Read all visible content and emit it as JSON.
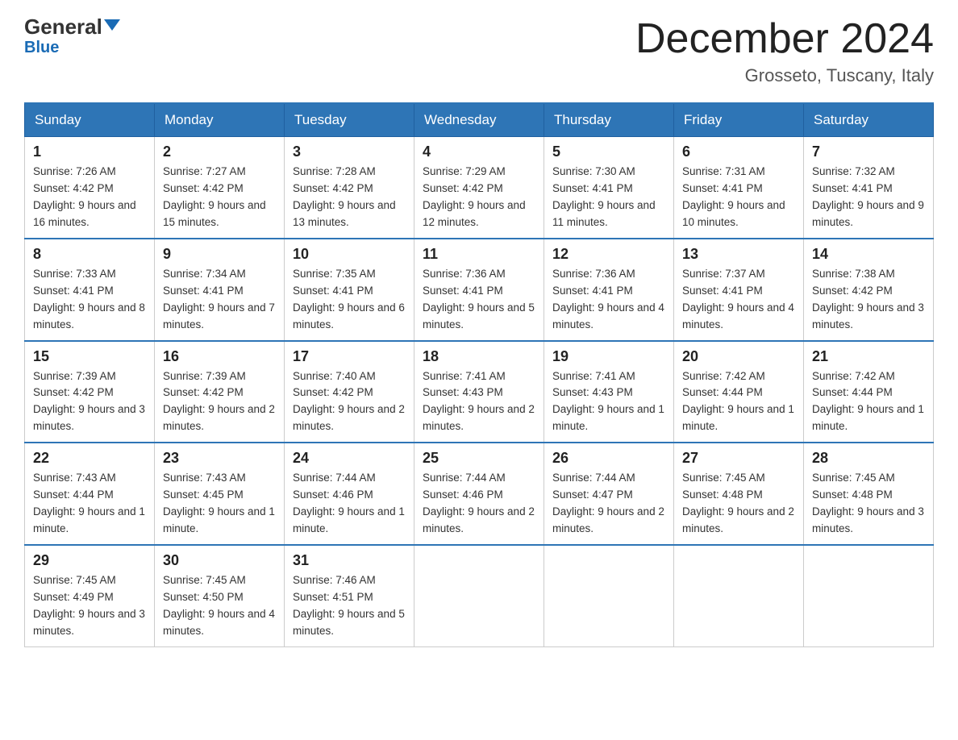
{
  "header": {
    "logo_general": "General",
    "logo_blue": "Blue",
    "month_title": "December 2024",
    "location": "Grosseto, Tuscany, Italy"
  },
  "days_of_week": [
    "Sunday",
    "Monday",
    "Tuesday",
    "Wednesday",
    "Thursday",
    "Friday",
    "Saturday"
  ],
  "weeks": [
    [
      {
        "day": "1",
        "sunrise": "7:26 AM",
        "sunset": "4:42 PM",
        "daylight": "9 hours and 16 minutes."
      },
      {
        "day": "2",
        "sunrise": "7:27 AM",
        "sunset": "4:42 PM",
        "daylight": "9 hours and 15 minutes."
      },
      {
        "day": "3",
        "sunrise": "7:28 AM",
        "sunset": "4:42 PM",
        "daylight": "9 hours and 13 minutes."
      },
      {
        "day": "4",
        "sunrise": "7:29 AM",
        "sunset": "4:42 PM",
        "daylight": "9 hours and 12 minutes."
      },
      {
        "day": "5",
        "sunrise": "7:30 AM",
        "sunset": "4:41 PM",
        "daylight": "9 hours and 11 minutes."
      },
      {
        "day": "6",
        "sunrise": "7:31 AM",
        "sunset": "4:41 PM",
        "daylight": "9 hours and 10 minutes."
      },
      {
        "day": "7",
        "sunrise": "7:32 AM",
        "sunset": "4:41 PM",
        "daylight": "9 hours and 9 minutes."
      }
    ],
    [
      {
        "day": "8",
        "sunrise": "7:33 AM",
        "sunset": "4:41 PM",
        "daylight": "9 hours and 8 minutes."
      },
      {
        "day": "9",
        "sunrise": "7:34 AM",
        "sunset": "4:41 PM",
        "daylight": "9 hours and 7 minutes."
      },
      {
        "day": "10",
        "sunrise": "7:35 AM",
        "sunset": "4:41 PM",
        "daylight": "9 hours and 6 minutes."
      },
      {
        "day": "11",
        "sunrise": "7:36 AM",
        "sunset": "4:41 PM",
        "daylight": "9 hours and 5 minutes."
      },
      {
        "day": "12",
        "sunrise": "7:36 AM",
        "sunset": "4:41 PM",
        "daylight": "9 hours and 4 minutes."
      },
      {
        "day": "13",
        "sunrise": "7:37 AM",
        "sunset": "4:41 PM",
        "daylight": "9 hours and 4 minutes."
      },
      {
        "day": "14",
        "sunrise": "7:38 AM",
        "sunset": "4:42 PM",
        "daylight": "9 hours and 3 minutes."
      }
    ],
    [
      {
        "day": "15",
        "sunrise": "7:39 AM",
        "sunset": "4:42 PM",
        "daylight": "9 hours and 3 minutes."
      },
      {
        "day": "16",
        "sunrise": "7:39 AM",
        "sunset": "4:42 PM",
        "daylight": "9 hours and 2 minutes."
      },
      {
        "day": "17",
        "sunrise": "7:40 AM",
        "sunset": "4:42 PM",
        "daylight": "9 hours and 2 minutes."
      },
      {
        "day": "18",
        "sunrise": "7:41 AM",
        "sunset": "4:43 PM",
        "daylight": "9 hours and 2 minutes."
      },
      {
        "day": "19",
        "sunrise": "7:41 AM",
        "sunset": "4:43 PM",
        "daylight": "9 hours and 1 minute."
      },
      {
        "day": "20",
        "sunrise": "7:42 AM",
        "sunset": "4:44 PM",
        "daylight": "9 hours and 1 minute."
      },
      {
        "day": "21",
        "sunrise": "7:42 AM",
        "sunset": "4:44 PM",
        "daylight": "9 hours and 1 minute."
      }
    ],
    [
      {
        "day": "22",
        "sunrise": "7:43 AM",
        "sunset": "4:44 PM",
        "daylight": "9 hours and 1 minute."
      },
      {
        "day": "23",
        "sunrise": "7:43 AM",
        "sunset": "4:45 PM",
        "daylight": "9 hours and 1 minute."
      },
      {
        "day": "24",
        "sunrise": "7:44 AM",
        "sunset": "4:46 PM",
        "daylight": "9 hours and 1 minute."
      },
      {
        "day": "25",
        "sunrise": "7:44 AM",
        "sunset": "4:46 PM",
        "daylight": "9 hours and 2 minutes."
      },
      {
        "day": "26",
        "sunrise": "7:44 AM",
        "sunset": "4:47 PM",
        "daylight": "9 hours and 2 minutes."
      },
      {
        "day": "27",
        "sunrise": "7:45 AM",
        "sunset": "4:48 PM",
        "daylight": "9 hours and 2 minutes."
      },
      {
        "day": "28",
        "sunrise": "7:45 AM",
        "sunset": "4:48 PM",
        "daylight": "9 hours and 3 minutes."
      }
    ],
    [
      {
        "day": "29",
        "sunrise": "7:45 AM",
        "sunset": "4:49 PM",
        "daylight": "9 hours and 3 minutes."
      },
      {
        "day": "30",
        "sunrise": "7:45 AM",
        "sunset": "4:50 PM",
        "daylight": "9 hours and 4 minutes."
      },
      {
        "day": "31",
        "sunrise": "7:46 AM",
        "sunset": "4:51 PM",
        "daylight": "9 hours and 5 minutes."
      },
      null,
      null,
      null,
      null
    ]
  ]
}
